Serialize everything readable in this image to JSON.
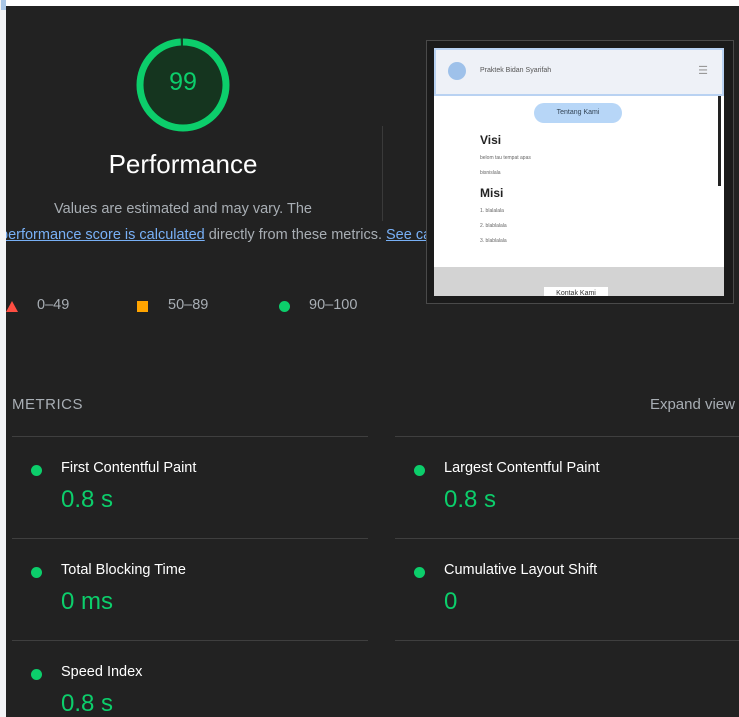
{
  "colors": {
    "background": "#222222",
    "pass": "#0cce6b",
    "average": "#ffa400",
    "fail": "#ff4e42",
    "link": "#78b0f6"
  },
  "score": {
    "value": "99",
    "fraction": 0.99,
    "title": "Performance"
  },
  "description": {
    "part1": "Values are estimated and may vary. The",
    "link1": "performance score is calculated",
    "part2": " directly from these metrics. ",
    "link2": "See calculator."
  },
  "legend": [
    {
      "icon": "triangle-icon",
      "label": "0–49"
    },
    {
      "icon": "square-icon",
      "label": "50–89"
    },
    {
      "icon": "circle-icon",
      "label": "90–100"
    }
  ],
  "thumbnail": {
    "brand": "Praktek Bidan Syarifah",
    "pill": "Tentang Kami",
    "heading1": "Visi",
    "visi_lines": [
      "belom tau tempat apas",
      "bisnislala"
    ],
    "heading2": "Misi",
    "misi_lines": [
      "1. blalalala",
      "2. blablalala",
      "3. blablalala"
    ],
    "footer_button": "Kontak Kami"
  },
  "metrics": {
    "title": "METRICS",
    "expand": "Expand view",
    "items": [
      {
        "name": "First Contentful Paint",
        "value": "0.8 s"
      },
      {
        "name": "Largest Contentful Paint",
        "value": "0.8 s"
      },
      {
        "name": "Total Blocking Time",
        "value": "0 ms"
      },
      {
        "name": "Cumulative Layout Shift",
        "value": "0"
      },
      {
        "name": "Speed Index",
        "value": "0.8 s"
      }
    ]
  }
}
